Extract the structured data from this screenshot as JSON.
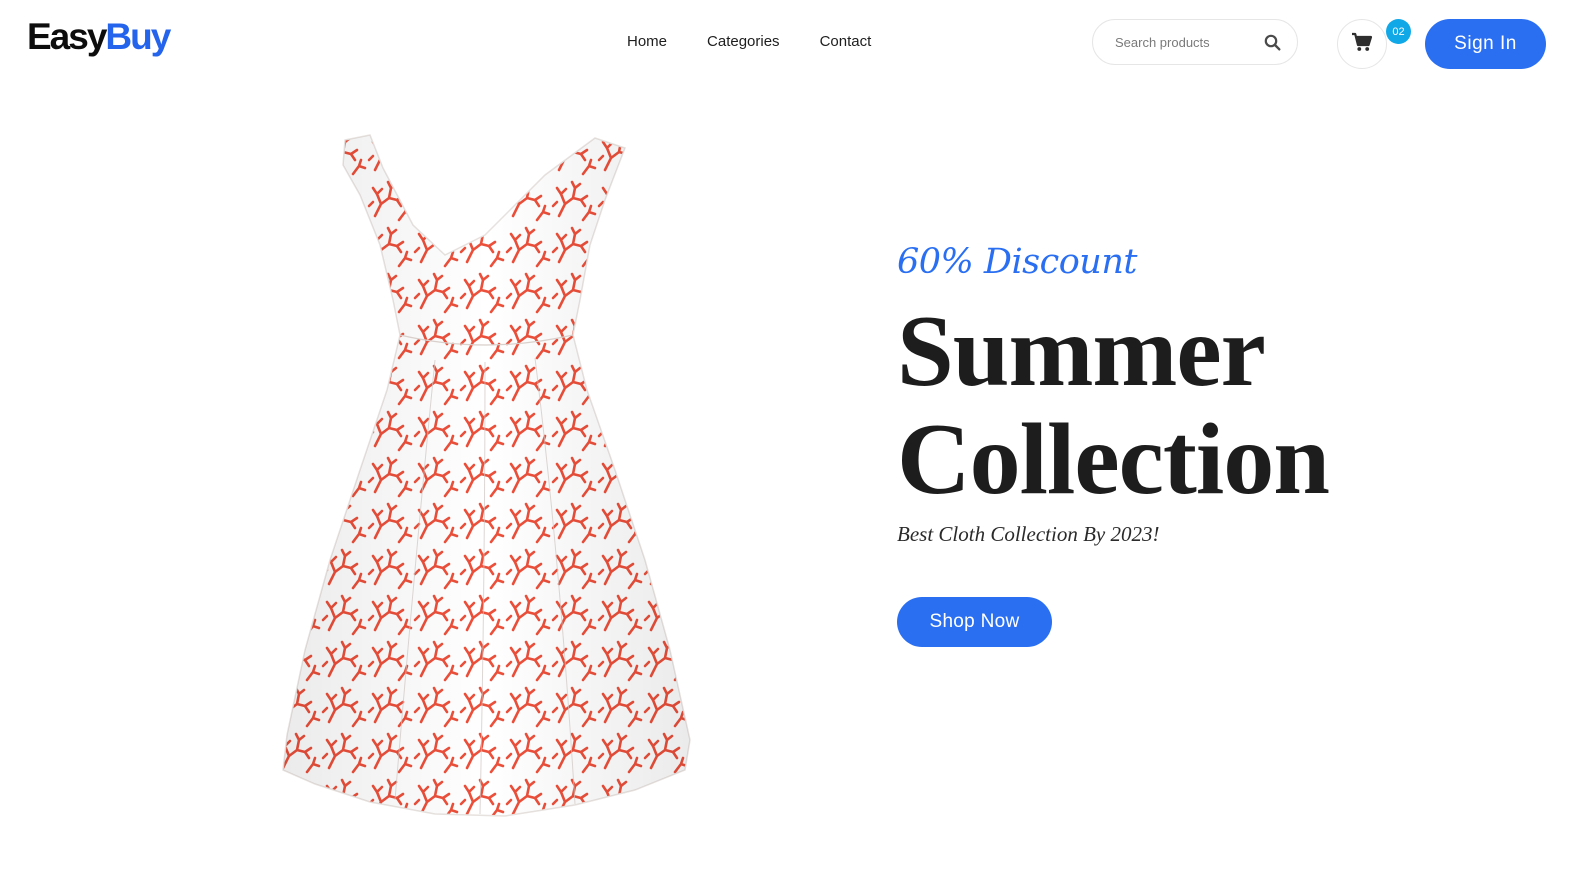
{
  "brand": {
    "logo_text_a": "Easy",
    "logo_text_b": "Buy",
    "accent_color": "#2463eb"
  },
  "nav": {
    "items": [
      {
        "label": "Home"
      },
      {
        "label": "Categories"
      },
      {
        "label": "Contact"
      }
    ]
  },
  "search": {
    "placeholder": "Search products",
    "icon": "search-icon"
  },
  "cart": {
    "icon": "cart-icon",
    "count": "02",
    "badge_color": "#11a8e8"
  },
  "auth": {
    "signin_label": "Sign In",
    "button_color": "#2a6ff2"
  },
  "hero": {
    "discount": "60% Discount",
    "headline_line1": "Summer",
    "headline_line2": "Collection",
    "tagline": "Best Cloth Collection By 2023!",
    "cta_label": "Shop Now",
    "product_colors": {
      "fabric": "#ffffff",
      "pattern": "#ec4f3a"
    }
  }
}
